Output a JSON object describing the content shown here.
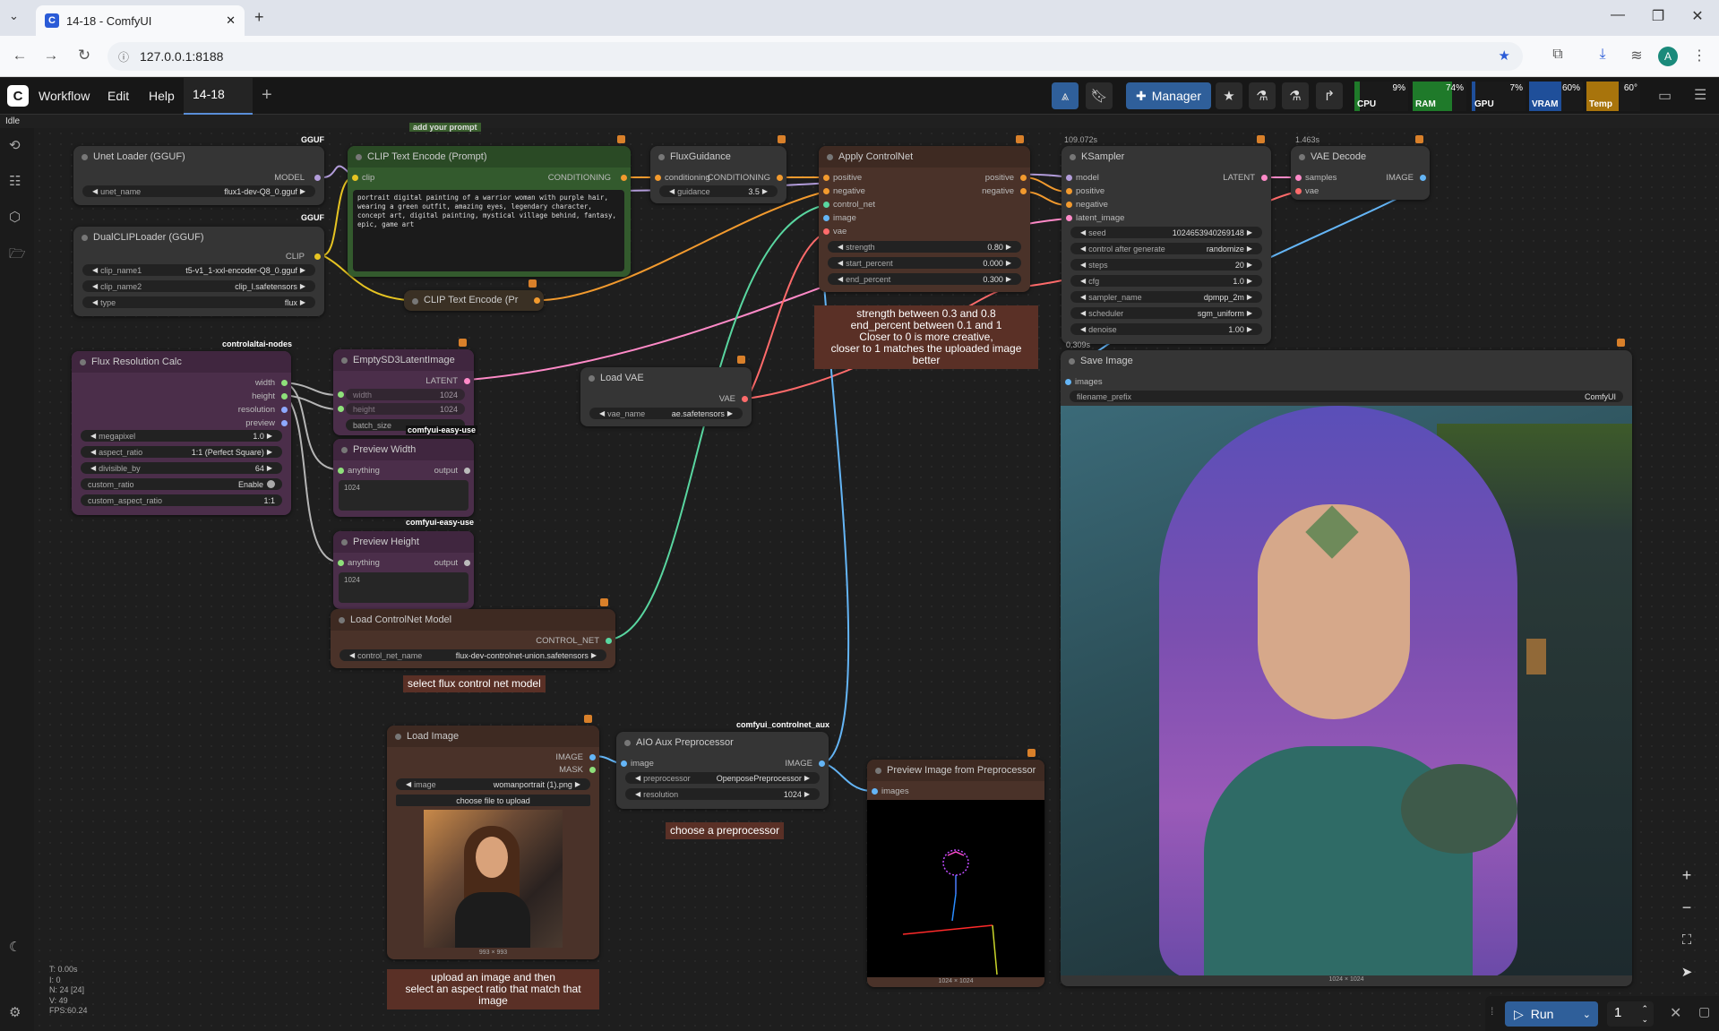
{
  "browser": {
    "tab_title": "14-18 - ComfyUI",
    "url": "127.0.0.1:8188",
    "avatar_letter": "A"
  },
  "menu": {
    "items": [
      "Workflow",
      "Edit",
      "Help"
    ],
    "workflow_tab": "14-18",
    "manager_label": "Manager",
    "status": "Idle"
  },
  "monitors": [
    {
      "label": "CPU",
      "value": "9%",
      "color": "#1f7a2a"
    },
    {
      "label": "RAM",
      "value": "74%",
      "color": "#1f7a2a"
    },
    {
      "label": "GPU",
      "value": "7%",
      "color": "#1f4f9a"
    },
    {
      "label": "VRAM",
      "value": "60%",
      "color": "#1f4f9a"
    },
    {
      "label": "Temp",
      "value": "60°",
      "color": "#a8740c"
    }
  ],
  "nodes": {
    "unet": {
      "title": "Unet Loader (GGUF)",
      "out": "MODEL",
      "w_label": "unet_name",
      "w_value": "flux1-dev-Q8_0.gguf",
      "badge": "GGUF"
    },
    "dualclip": {
      "title": "DualCLIPLoader (GGUF)",
      "out": "CLIP",
      "badge": "GGUF",
      "widgets": [
        {
          "label": "clip_name1",
          "value": "t5-v1_1-xxl-encoder-Q8_0.gguf"
        },
        {
          "label": "clip_name2",
          "value": "clip_l.safetensors"
        },
        {
          "label": "type",
          "value": "flux"
        }
      ]
    },
    "clip_text": {
      "title": "CLIP Text Encode (Prompt)",
      "in": "clip",
      "out": "CONDITIONING",
      "header_note": "add your prompt",
      "prompt": "portrait digital painting of a warrior woman with purple hair, wearing a green outfit, amazing eyes, legendary character, concept art, digital painting, mystical village behind, fantasy, epic, game art"
    },
    "clip_text2": {
      "title": "CLIP Text Encode (Pr"
    },
    "flux_guidance": {
      "title": "FluxGuidance",
      "in": "conditioning",
      "out": "CONDITIONING",
      "w_label": "guidance",
      "w_value": "3.5"
    },
    "apply_cn": {
      "title": "Apply ControlNet",
      "inputs": [
        "positive",
        "negative",
        "control_net",
        "image",
        "vae"
      ],
      "outputs": [
        "positive",
        "negative"
      ],
      "widgets": [
        {
          "label": "strength",
          "value": "0.80"
        },
        {
          "label": "start_percent",
          "value": "0.000"
        },
        {
          "label": "end_percent",
          "value": "0.300"
        }
      ]
    },
    "ksampler": {
      "title": "KSampler",
      "time": "109.072s",
      "time2": "0.309s",
      "inputs": [
        "model",
        "positive",
        "negative",
        "latent_image"
      ],
      "out": "LATENT",
      "widgets": [
        {
          "label": "seed",
          "value": "1024653940269148"
        },
        {
          "label": "control after generate",
          "value": "randomize"
        },
        {
          "label": "steps",
          "value": "20"
        },
        {
          "label": "cfg",
          "value": "1.0"
        },
        {
          "label": "sampler_name",
          "value": "dpmpp_2m"
        },
        {
          "label": "scheduler",
          "value": "sgm_uniform"
        },
        {
          "label": "denoise",
          "value": "1.00"
        }
      ]
    },
    "vae_decode": {
      "title": "VAE Decode",
      "time": "1.463s",
      "inputs": [
        "samples",
        "vae"
      ],
      "out": "IMAGE"
    },
    "flux_res": {
      "title": "Flux Resolution Calc",
      "badge": "controlaltai-nodes",
      "outputs": [
        "width",
        "height",
        "resolution",
        "preview"
      ],
      "widgets": [
        {
          "label": "megapixel",
          "value": "1.0"
        },
        {
          "label": "aspect_ratio",
          "value": "1:1 (Perfect Square)"
        },
        {
          "label": "divisible_by",
          "value": "64"
        },
        {
          "label": "custom_ratio",
          "value": "Enable"
        },
        {
          "label": "custom_aspect_ratio",
          "value": "1:1"
        }
      ]
    },
    "empty_latent": {
      "title": "EmptySD3LatentImage",
      "out": "LATENT",
      "widgets": [
        {
          "label": "width",
          "value": "1024"
        },
        {
          "label": "height",
          "value": "1024"
        },
        {
          "label": "batch_size",
          "value": ""
        }
      ],
      "badge": "comfyui-easy-use"
    },
    "preview_width": {
      "title": "Preview Width",
      "in": "anything",
      "out": "output",
      "value": "1024",
      "badge": "comfyui-easy-use"
    },
    "preview_height": {
      "title": "Preview Height",
      "in": "anything",
      "out": "output",
      "value": "1024"
    },
    "load_vae": {
      "title": "Load VAE",
      "out": "VAE",
      "w_label": "vae_name",
      "w_value": "ae.safetensors"
    },
    "load_cn": {
      "title": "Load ControlNet Model",
      "out": "CONTROL_NET",
      "w_label": "control_net_name",
      "w_value": "flux-dev-controlnet-union.safetensors"
    },
    "load_image": {
      "title": "Load Image",
      "outputs": [
        "IMAGE",
        "MASK"
      ],
      "w_label": "image",
      "w_value": "womanportrait (1).png",
      "upload_label": "choose file to upload",
      "size": "993 × 993"
    },
    "aio_aux": {
      "title": "AIO Aux Preprocessor",
      "badge": "comfyui_controlnet_aux",
      "in": "image",
      "out": "IMAGE",
      "widgets": [
        {
          "label": "preprocessor",
          "value": "OpenposePreprocessor"
        },
        {
          "label": "resolution",
          "value": "1024"
        }
      ]
    },
    "preview_pre": {
      "title": "Preview Image from Preprocessor",
      "in": "images",
      "size": "1024 × 1024"
    },
    "save_image": {
      "title": "Save Image",
      "in": "images",
      "w_label": "filename_prefix",
      "w_value": "ComfyUI",
      "size": "1024 × 1024"
    }
  },
  "notes": {
    "strength": "strength between 0.3 and 0.8\nend_percent between 0.1 and 1\nCloser to 0 is more creative,\ncloser to 1 matches the uploaded image better",
    "controlnet": "select flux control net model",
    "preprocessor": "choose a preprocessor",
    "upload": "upload an image and then\nselect an aspect ratio that match that image"
  },
  "stats": [
    "T: 0.00s",
    "I: 0",
    "N: 24 [24]",
    "V: 49",
    "FPS:60.24"
  ],
  "run": {
    "label": "Run",
    "count": "1"
  },
  "icons": [
    "history-icon",
    "queue-icon",
    "model-library-icon",
    "workflows-icon",
    "theme-icon",
    "settings-icon",
    "zoom-in-icon",
    "zoom-out-icon",
    "fit-view-icon",
    "pointer-icon"
  ]
}
